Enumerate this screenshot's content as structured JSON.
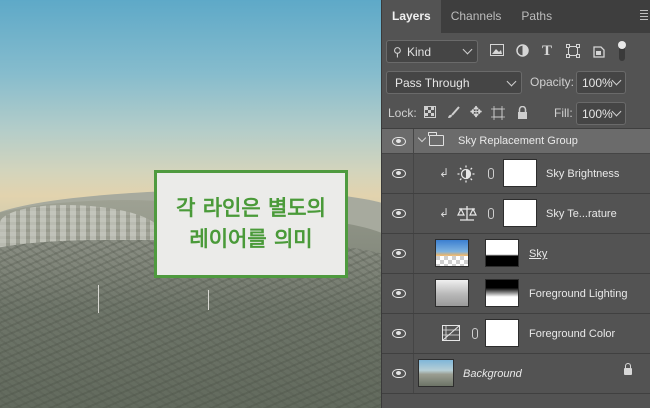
{
  "annotation": {
    "line1": "각 라인은 별도의",
    "line2": "레이어를 의미"
  },
  "panel": {
    "tabs": [
      {
        "label": "Layers",
        "active": true
      },
      {
        "label": "Channels",
        "active": false
      },
      {
        "label": "Paths",
        "active": false
      }
    ],
    "filter": {
      "kind_label": "Kind",
      "icons": [
        "image-filter-icon",
        "adjustment-filter-icon",
        "type-filter-icon",
        "shape-filter-icon",
        "smart-object-filter-icon",
        "filter-toggle-icon"
      ]
    },
    "blend_mode": "Pass Through",
    "opacity_label": "Opacity:",
    "opacity_value": "100%",
    "lock_label": "Lock:",
    "fill_label": "Fill:",
    "fill_value": "100%",
    "lock_icons": [
      "lock-transparent-icon",
      "lock-paint-icon",
      "lock-position-icon",
      "lock-artboard-icon",
      "lock-all-icon"
    ]
  },
  "layers": [
    {
      "name": "Sky Replacement Group",
      "type": "group",
      "expanded": true
    },
    {
      "name": "Sky Brightness",
      "type": "adjustment",
      "icon": "brightness-icon",
      "clipped": true
    },
    {
      "name": "Sky Te...rature",
      "type": "adjustment",
      "icon": "color-balance-icon",
      "clipped": true
    },
    {
      "name": "Sky",
      "type": "image",
      "underlined": true
    },
    {
      "name": "Foreground Lighting",
      "type": "image"
    },
    {
      "name": "Foreground Color",
      "type": "adjustment",
      "icon": "gradient-map-icon"
    },
    {
      "name": "Background",
      "type": "image",
      "italic": true,
      "locked": true
    }
  ],
  "colors": {
    "accent_green": "#4f9a3f",
    "panel_bg": "#535353",
    "group_row_bg": "#6b6b6b"
  }
}
